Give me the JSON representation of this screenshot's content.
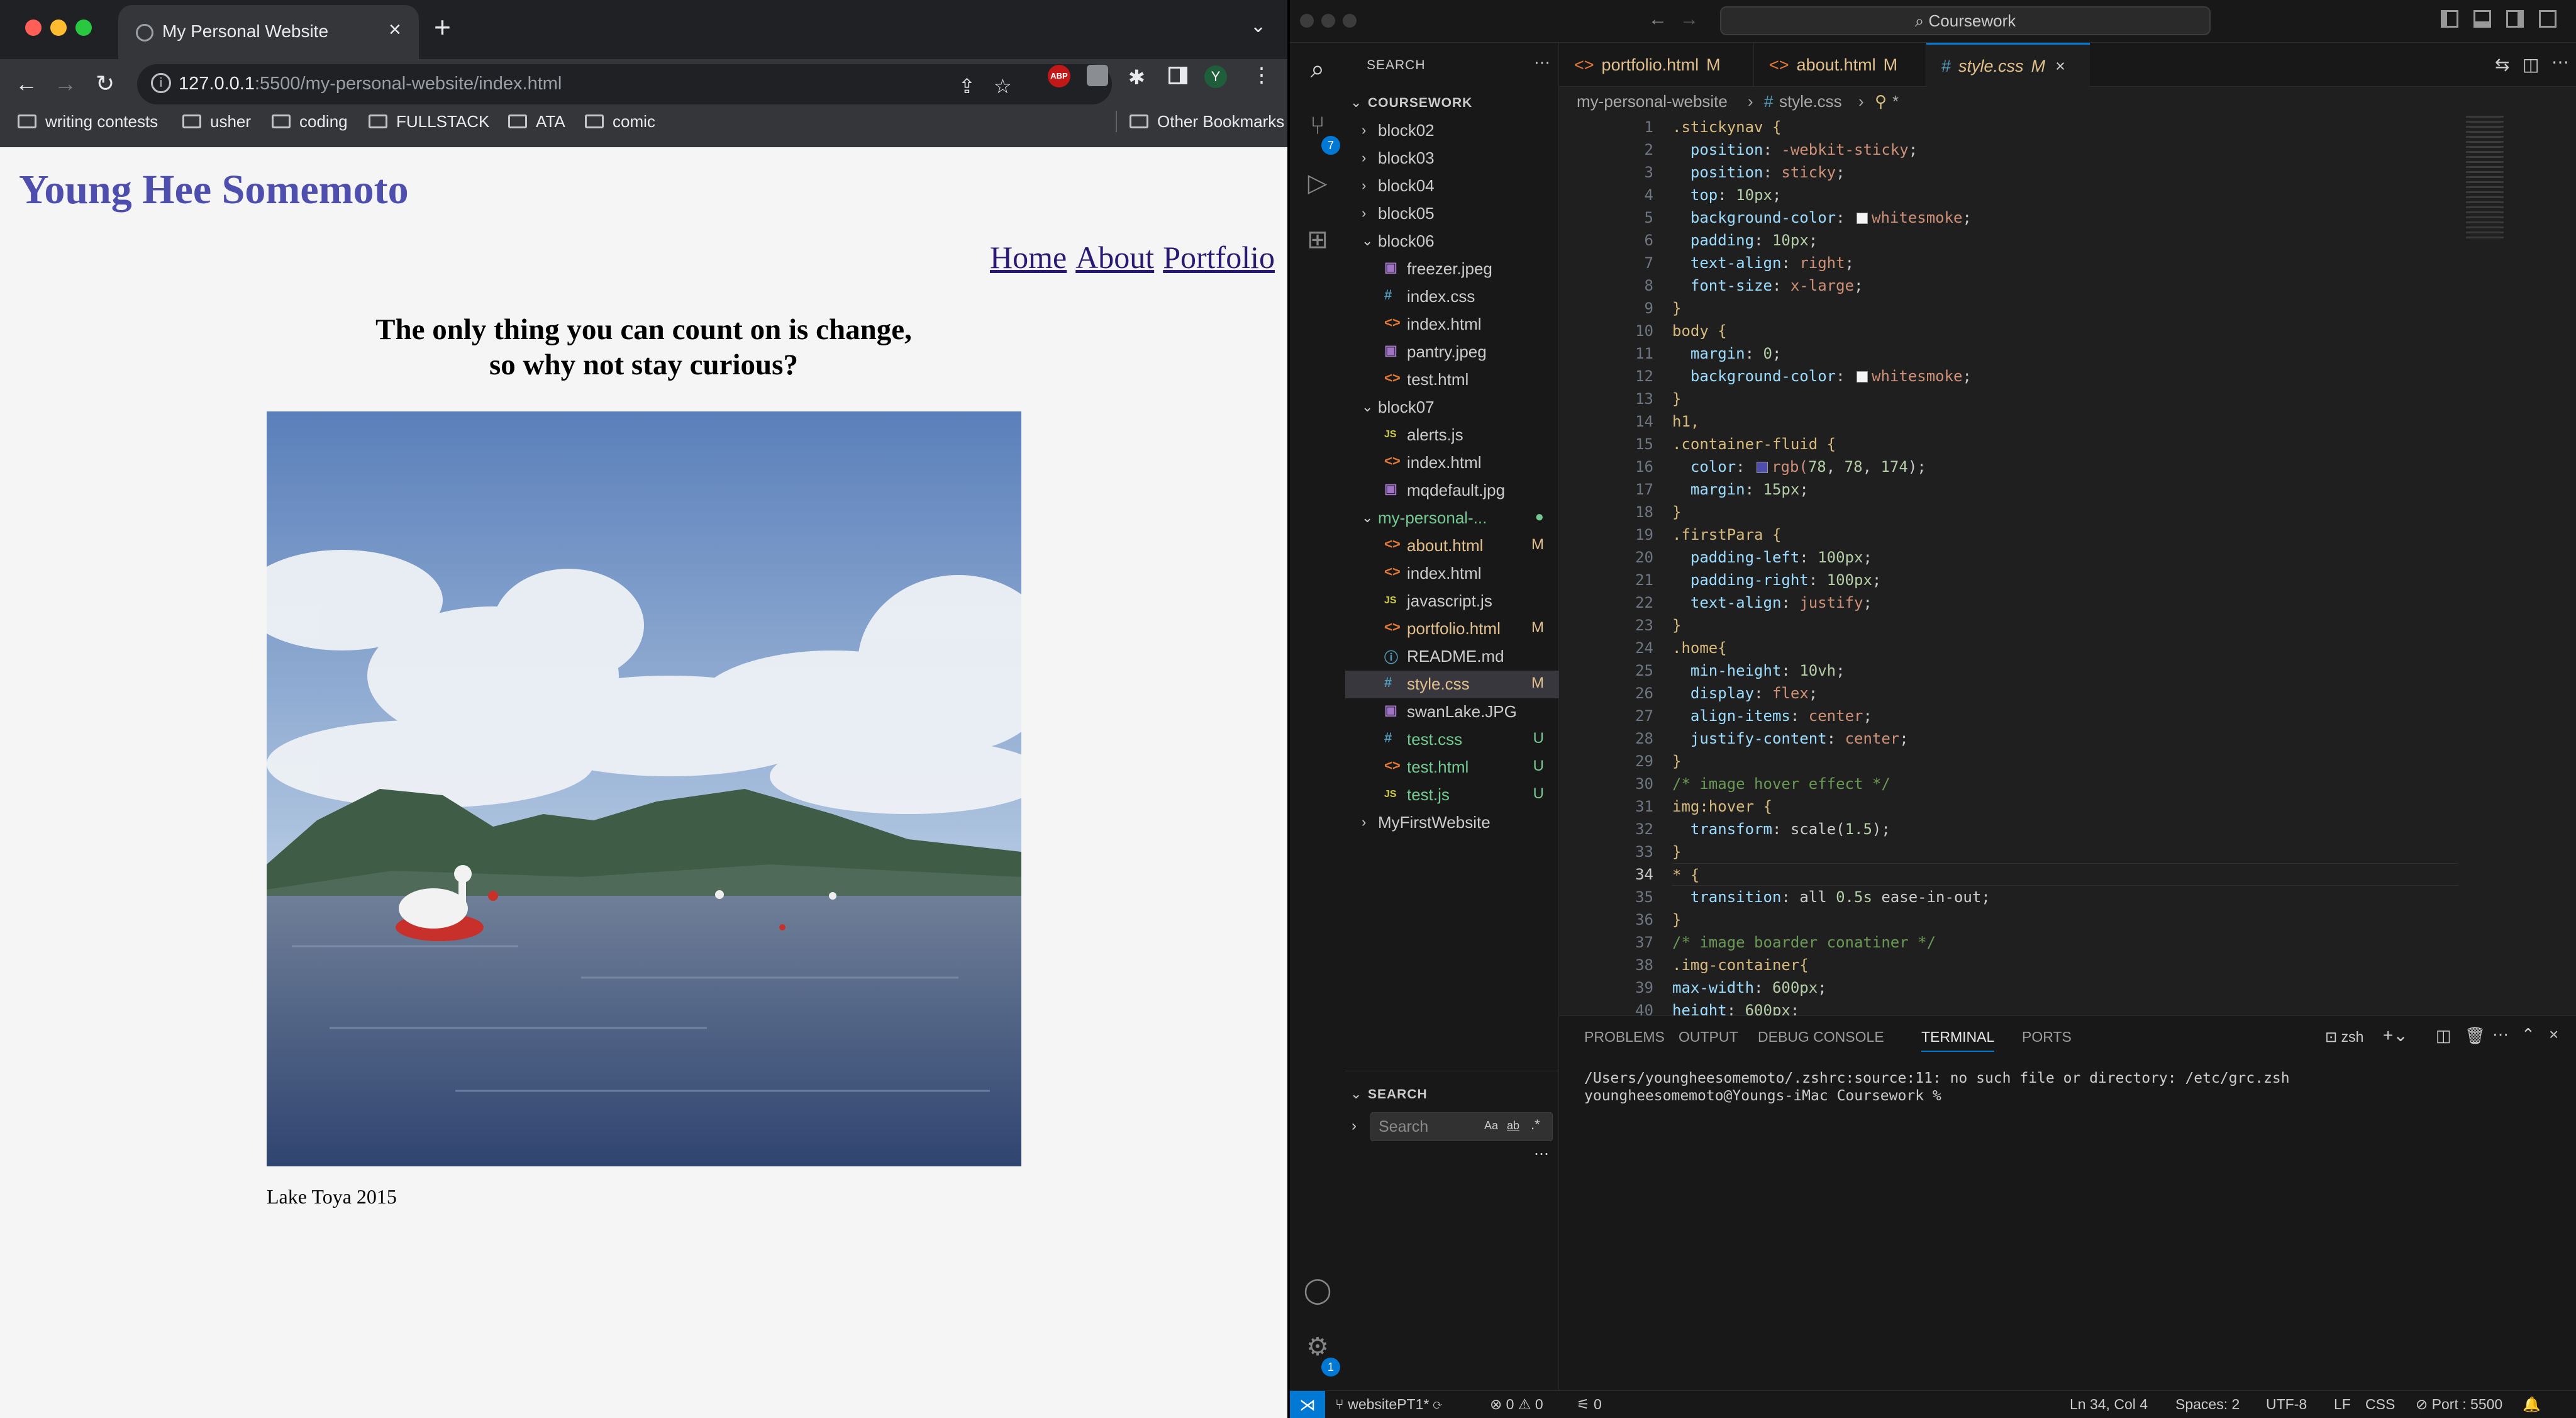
{
  "browser": {
    "tab_title": "My Personal Website",
    "url_host": "127.0.0.1",
    "url_rest": ":5500/my-personal-website/index.html",
    "bookmarks": [
      "writing contests",
      "usher",
      "coding",
      "FULLSTACK",
      "ATA",
      "comic"
    ],
    "other_bookmarks": "Other Bookmarks",
    "ext_abp": "ABP",
    "avatar_letter": "Y"
  },
  "site": {
    "title": "Young Hee Somemoto",
    "nav": [
      "Home",
      "About",
      "Portfolio"
    ],
    "quote_line1": "The only thing you can count on is change,",
    "quote_line2": "so why not stay curious?",
    "caption": "Lake Toya 2015",
    "title_color": "#4e4eae"
  },
  "vscode": {
    "command_center": "Coursework",
    "source_control_badge": "7",
    "settings_badge": "1",
    "explorer_header": "SEARCH",
    "root": "COURSEWORK",
    "tree": [
      {
        "label": "block02",
        "type": "folder",
        "depth": 0,
        "open": false
      },
      {
        "label": "block03",
        "type": "folder",
        "depth": 0,
        "open": false
      },
      {
        "label": "block04",
        "type": "folder",
        "depth": 0,
        "open": false
      },
      {
        "label": "block05",
        "type": "folder",
        "depth": 0,
        "open": false
      },
      {
        "label": "block06",
        "type": "folder",
        "depth": 0,
        "open": true
      },
      {
        "label": "freezer.jpeg",
        "type": "img",
        "depth": 1
      },
      {
        "label": "index.css",
        "type": "css",
        "depth": 1
      },
      {
        "label": "index.html",
        "type": "html",
        "depth": 1
      },
      {
        "label": "pantry.jpeg",
        "type": "img",
        "depth": 1
      },
      {
        "label": "test.html",
        "type": "html",
        "depth": 1
      },
      {
        "label": "block07",
        "type": "folder",
        "depth": 0,
        "open": true
      },
      {
        "label": "alerts.js",
        "type": "js",
        "depth": 1
      },
      {
        "label": "index.html",
        "type": "html",
        "depth": 1
      },
      {
        "label": "mqdefault.jpg",
        "type": "img",
        "depth": 1
      },
      {
        "label": "my-personal-...",
        "type": "folder",
        "depth": 0,
        "open": true,
        "status": "●",
        "color": "#73c991"
      },
      {
        "label": "about.html",
        "type": "html",
        "depth": 1,
        "status": "M",
        "color": "#e2c08d"
      },
      {
        "label": "index.html",
        "type": "html",
        "depth": 1
      },
      {
        "label": "javascript.js",
        "type": "js",
        "depth": 1
      },
      {
        "label": "portfolio.html",
        "type": "html",
        "depth": 1,
        "status": "M",
        "color": "#e2c08d"
      },
      {
        "label": "README.md",
        "type": "md",
        "depth": 1
      },
      {
        "label": "style.css",
        "type": "css",
        "depth": 1,
        "status": "M",
        "color": "#e2c08d",
        "selected": true
      },
      {
        "label": "swanLake.JPG",
        "type": "img",
        "depth": 1
      },
      {
        "label": "test.css",
        "type": "css",
        "depth": 1,
        "status": "U",
        "color": "#73c991"
      },
      {
        "label": "test.html",
        "type": "html",
        "depth": 1,
        "status": "U",
        "color": "#73c991"
      },
      {
        "label": "test.js",
        "type": "js",
        "depth": 1,
        "status": "U",
        "color": "#73c991"
      },
      {
        "label": "MyFirstWebsite",
        "type": "folder",
        "depth": 0,
        "open": false
      }
    ],
    "search_section": "SEARCH",
    "search_placeholder": "Search",
    "tabs": [
      {
        "label": "portfolio.html",
        "status": "M",
        "active": false
      },
      {
        "label": "about.html",
        "status": "M",
        "active": false
      },
      {
        "label": "style.css",
        "status": "M",
        "active": true
      }
    ],
    "breadcrumb": [
      "my-personal-website",
      "style.css",
      "*"
    ],
    "code": [
      ".stickynav {",
      "  position: -webkit-sticky;",
      "  position: sticky;",
      "  top: 10px;",
      "  background-color: whitesmoke;",
      "  padding: 10px;",
      "  text-align: right;",
      "  font-size: x-large;",
      "}",
      "body {",
      "  margin: 0;",
      "  background-color: whitesmoke;",
      "}",
      "h1,",
      ".container-fluid {",
      "  color: rgb(78, 78, 174);",
      "  margin: 15px;",
      "}",
      ".firstPara {",
      "  padding-left: 100px;",
      "  padding-right: 100px;",
      "  text-align: justify;",
      "}",
      ".home{",
      "  min-height: 10vh;",
      "  display: flex;",
      "  align-items: center;",
      "  justify-content: center;",
      "}",
      "/* image hover effect */",
      "img:hover {",
      "  transform: scale(1.5);",
      "}",
      "* {",
      "  transition: all 0.5s ease-in-out;",
      "}",
      "/* image boarder conatiner */",
      ".img-container{",
      "max-width: 600px;",
      "height: 600px;"
    ],
    "panel_tabs": [
      "PROBLEMS",
      "OUTPUT",
      "DEBUG CONSOLE",
      "TERMINAL",
      "PORTS"
    ],
    "panel_shell": "zsh",
    "terminal": [
      "/Users/youngheesomemoto/.zshrc:source:11: no such file or directory: /etc/grc.zsh",
      "youngheesomemoto@Youngs-iMac Coursework %"
    ],
    "status": {
      "branch": "websitePT1*",
      "errors": "0",
      "warnings": "0",
      "ports": "0",
      "position": "Ln 34, Col 4",
      "spaces": "Spaces: 2",
      "encoding": "UTF-8",
      "eol": "LF",
      "language": "CSS",
      "port": "Port : 5500"
    },
    "accent": "#0078d4"
  }
}
